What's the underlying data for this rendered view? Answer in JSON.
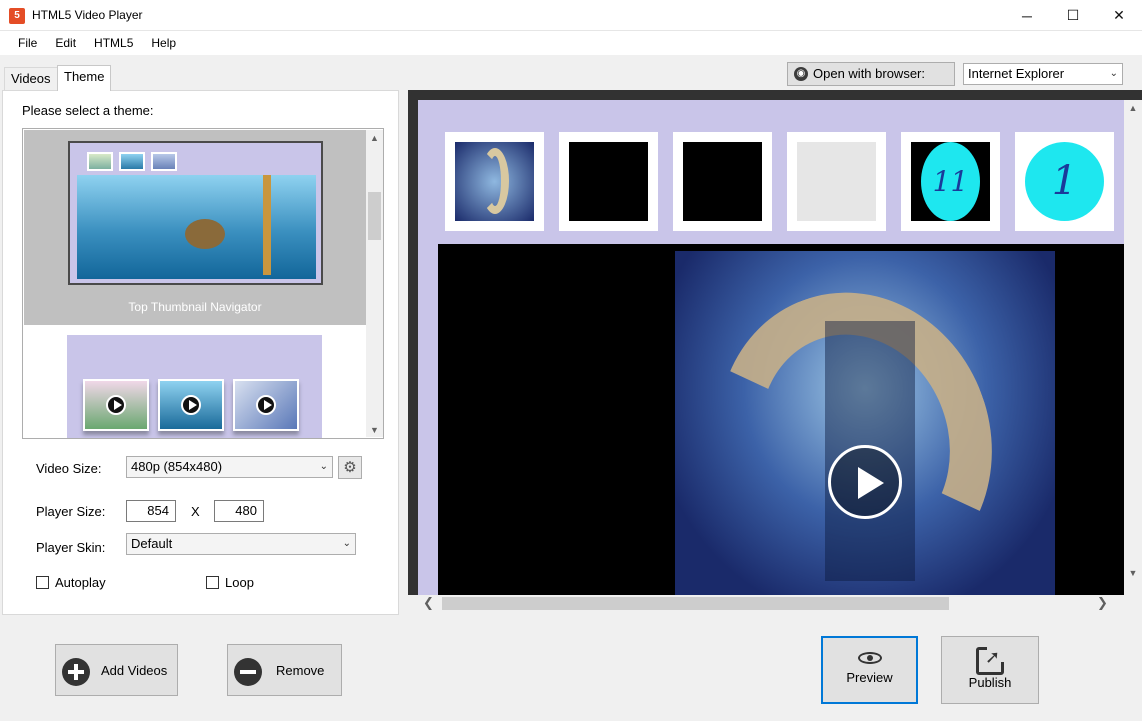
{
  "window": {
    "title": "HTML5 Video Player",
    "controls": {
      "minimize": "─",
      "maximize": "☐",
      "close": "✕"
    }
  },
  "menu": [
    "File",
    "Edit",
    "HTML5",
    "Help"
  ],
  "tabs": [
    "Videos",
    "Theme"
  ],
  "theme": {
    "select_label": "Please select a theme:",
    "items": [
      {
        "caption": "Top Thumbnail Navigator"
      }
    ]
  },
  "settings": {
    "video_size_label": "Video Size:",
    "video_size_value": "480p (854x480)",
    "player_size_label": "Player Size:",
    "player_width": "854",
    "size_separator": "X",
    "player_height": "480",
    "skin_label": "Player Skin:",
    "skin_value": "Default",
    "autoplay_label": "Autoplay",
    "loop_label": "Loop"
  },
  "browser": {
    "open_label": "Open with browser:",
    "selected": "Internet Explorer"
  },
  "preview": {
    "nav_thumb_11": "11",
    "nav_thumb_1": "1"
  },
  "buttons": {
    "add_videos": "Add Videos",
    "remove": "Remove",
    "preview": "Preview",
    "publish": "Publish"
  },
  "colors": {
    "accent_border": "#0078d7",
    "theme_bg": "#c9c5e9"
  }
}
